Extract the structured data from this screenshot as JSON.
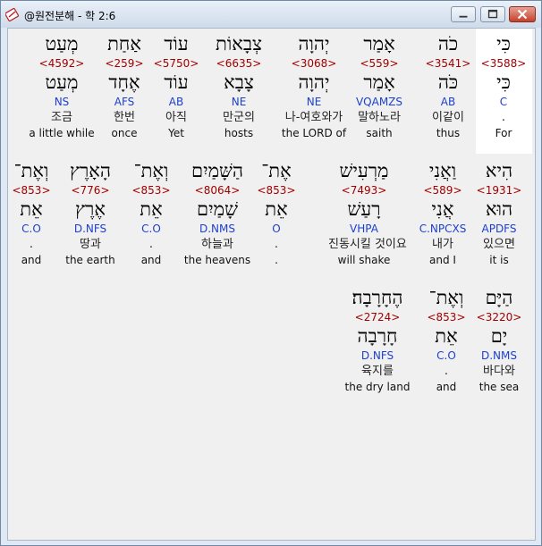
{
  "window": {
    "title": "@원전분해 - 학 2:6"
  },
  "rows": [
    [
      {
        "heb": "כִּי",
        "strong": "<3588>",
        "lemma": "כִּי",
        "morph": "C",
        "kor": ".",
        "eng": "For"
      },
      {
        "heb": "כֹה",
        "strong": "<3541>",
        "lemma": "כֹּה",
        "morph": "AB",
        "kor": "이같이",
        "eng": "thus"
      },
      {
        "heb": "אָמַר",
        "strong": "<559>",
        "lemma": "אָמַר",
        "morph": "VQAMZS",
        "kor": "말하노라",
        "eng": "saith"
      },
      {
        "heb": "יְהוָה",
        "strong": "<3068>",
        "lemma": "יְהוָה",
        "morph": "NE",
        "kor": "나-여호와가",
        "eng": "the LORD of"
      },
      {
        "heb": "צְבָאוֹת",
        "strong": "<6635>",
        "lemma": "צָבָא",
        "morph": "NE",
        "kor": "만군의",
        "eng": "hosts"
      },
      {
        "heb": "עוֹד",
        "strong": "<5750>",
        "lemma": "עוֹד",
        "morph": "AB",
        "kor": "아직",
        "eng": "Yet"
      },
      {
        "heb": "אַחַת",
        "strong": "<259>",
        "lemma": "אֶחָד",
        "morph": "AFS",
        "kor": "한번",
        "eng": "once"
      },
      {
        "heb": "מְעַט",
        "strong": "<4592>",
        "lemma": "מְעַט",
        "morph": "NS",
        "kor": "조금",
        "eng": "a little while"
      }
    ],
    [
      {
        "heb": "הִיא",
        "strong": "<1931>",
        "lemma": "הוּא",
        "morph": "APDFS",
        "kor": "있으면",
        "eng": "it is"
      },
      {
        "heb": "וַאֲנִי",
        "strong": "<589>",
        "lemma": "אֲנִי",
        "morph": "C.NPCXS",
        "kor": "내가",
        "eng": "and I"
      },
      {
        "heb": "מַרְעִישׁ",
        "strong": "<7493>",
        "lemma": "רָעַשׁ",
        "morph": "VHPA",
        "kor": "진동시킬 것이요",
        "eng": "will shake"
      },
      {
        "heb": "אֶת־",
        "strong": "<853>",
        "lemma": "אֵת",
        "morph": "O",
        "kor": ".",
        "eng": "."
      },
      {
        "heb": "הַשָּׁמַיִם",
        "strong": "<8064>",
        "lemma": "שָׁמַיִם",
        "morph": "D.NMS",
        "kor": "하늘과",
        "eng": "the heavens"
      },
      {
        "heb": "וְאֶת־",
        "strong": "<853>",
        "lemma": "אֵת",
        "morph": "C.O",
        "kor": ".",
        "eng": "and"
      },
      {
        "heb": "הָאָרֶץ",
        "strong": "<776>",
        "lemma": "אֶרֶץ",
        "morph": "D.NFS",
        "kor": "땅과",
        "eng": "the earth"
      },
      {
        "heb": "וְאֶת־",
        "strong": "<853>",
        "lemma": "אֵת",
        "morph": "C.O",
        "kor": ".",
        "eng": "and"
      }
    ],
    [
      {
        "heb": "הַיָּם",
        "strong": "<3220>",
        "lemma": "יָם",
        "morph": "D.NMS",
        "kor": "바다와",
        "eng": "the sea"
      },
      {
        "heb": "וְאֶת־",
        "strong": "<853>",
        "lemma": "אֵת",
        "morph": "C.O",
        "kor": ".",
        "eng": "and"
      },
      {
        "heb": "הֶחָרָבָה׃",
        "strong": "<2724>",
        "lemma": "חָרָבָה",
        "morph": "D.NFS",
        "kor": "육지를",
        "eng": "the dry land"
      }
    ]
  ],
  "colors": {
    "strong": "#a00000",
    "morph": "#1d3fcf",
    "selected": "#ffffff"
  },
  "icons": {
    "app": "bible-app-icon",
    "minimize": "minimize-icon",
    "maximize": "maximize-icon",
    "close": "close-icon"
  }
}
